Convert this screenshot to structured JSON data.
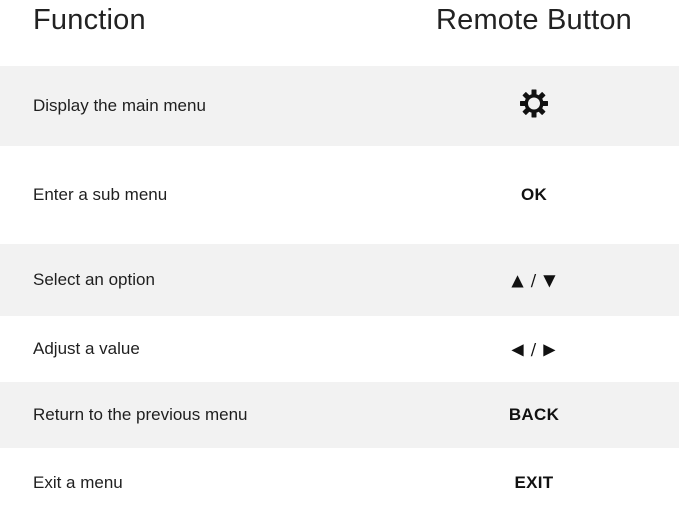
{
  "header": {
    "function_label": "Function",
    "button_label": "Remote Button"
  },
  "rows": [
    {
      "function": "Display the main menu",
      "button": "",
      "button_icon": "gear-icon"
    },
    {
      "function": "Enter a sub menu",
      "button": "OK"
    },
    {
      "function": "Select an option",
      "button": "▲ / ▼",
      "button_icon": "up-down-arrows"
    },
    {
      "function": "Adjust a value",
      "button": "◀ / ▶",
      "button_icon": "left-right-arrows"
    },
    {
      "function": "Return to the previous menu",
      "button": "BACK"
    },
    {
      "function": "Exit a menu",
      "button": "EXIT"
    }
  ],
  "colors": {
    "shaded_row": "#f2f2f2",
    "text": "#1f1f1f"
  }
}
